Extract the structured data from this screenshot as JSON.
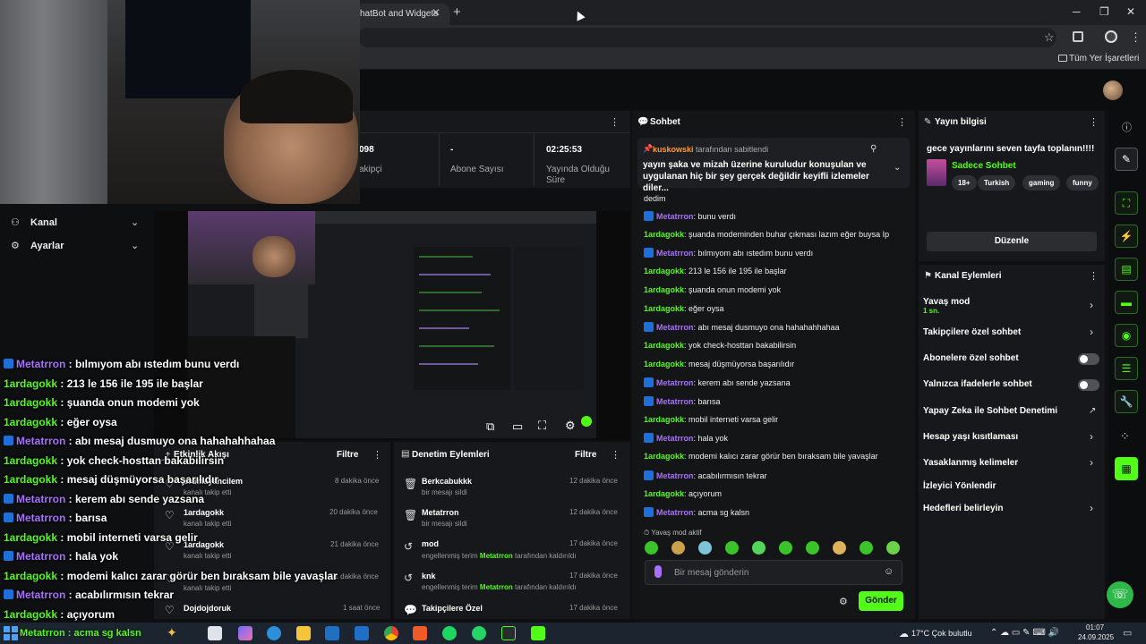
{
  "browser": {
    "tab_title": "hatBot and Widgets",
    "tab_close": "✕",
    "new_tab": "+",
    "bookmark": "Tüm Yer İşaretleri",
    "win_min": "─",
    "win_max": "❐",
    "win_close": "✕"
  },
  "stats": [
    {
      "value": "098",
      "label": "akipçi"
    },
    {
      "value": "-",
      "label": "Abone Sayısı"
    },
    {
      "value": "02:25:53",
      "label": "Yayında Olduğu Süre"
    }
  ],
  "menu": {
    "kanal": "Kanal",
    "ayarlar": "Ayarlar"
  },
  "overlay_chat": [
    {
      "user": "Metatrron",
      "msg": " : bılmıyom abı ıstedım bunu verdı",
      "badge": true
    },
    {
      "user": "1ardagokk",
      "msg": " : 213 le 156 ile 195 ile başlar",
      "badge": false
    },
    {
      "user": "1ardagokk",
      "msg": " : şuanda onun modemi yok",
      "badge": false
    },
    {
      "user": "1ardagokk",
      "msg": " : eğer oysa",
      "badge": false
    },
    {
      "user": "Metatrron",
      "msg": " : abı mesaj dusmuyo ona hahahahhahaa",
      "badge": true
    },
    {
      "user": "1ardagokk",
      "msg": " : yok check-hosttan bakabilirsin",
      "badge": false
    },
    {
      "user": "1ardagokk",
      "msg": " : mesaj düşmüyorsa başarılıdır",
      "badge": false
    },
    {
      "user": "Metatrron",
      "msg": " : kerem abı sende yazsana",
      "badge": true
    },
    {
      "user": "Metatrron",
      "msg": " : barısa",
      "badge": true
    },
    {
      "user": "1ardagokk",
      "msg": " : mobil interneti varsa gelir",
      "badge": false
    },
    {
      "user": "Metatrron",
      "msg": " : hala yok",
      "badge": true
    },
    {
      "user": "1ardagokk",
      "msg": " : modemi kalıcı zarar görür ben bıraksam bile yavaşlar",
      "badge": false
    },
    {
      "user": "Metatrron",
      "msg": " : acabılırmısın tekrar",
      "badge": true
    },
    {
      "user": "1ardagokk",
      "msg": " : açıyorum",
      "badge": false
    }
  ],
  "overlay_bottom": "Metatrron : acma sg kalsn",
  "activity": {
    "title": "Etkinlik Akışı",
    "filter": "Filtre",
    "rows": [
      {
        "name": "orumayancilem",
        "sub": "kanalı takip etti",
        "time": "8 dakika önce"
      },
      {
        "name": "1ardagokk",
        "sub": "kanalı takip etti",
        "time": "20 dakika önce"
      },
      {
        "name": "1ardagokk",
        "sub": "kanalı takip etti",
        "time": "21 dakika önce"
      },
      {
        "name": "",
        "sub": "kanalı takip etti",
        "time": "51 dakika önce"
      },
      {
        "name": "Dojdojdoruk",
        "sub": "",
        "time": "1 saat önce"
      }
    ]
  },
  "moderation": {
    "title": "Denetim Eylemleri",
    "filter": "Filtre",
    "rows": [
      {
        "name": "Berkcabukkk",
        "sub": "bir mesajı sildi",
        "time": "12 dakika önce"
      },
      {
        "name": "Metatrron",
        "sub": "bir mesajı sildi",
        "time": "12 dakika önce"
      },
      {
        "name": "mod",
        "sub_pre": "engellenmiş terim ",
        "sub_user": "Metatrron",
        "sub_post": " tarafından kaldırıldı",
        "time": "17 dakika önce"
      },
      {
        "name": "knk",
        "sub_pre": "engellenmiş terim ",
        "sub_user": "Metatrron",
        "sub_post": " tarafından kaldırıldı",
        "time": "17 dakika önce"
      },
      {
        "name": "Takipçilere Özel",
        "sub": "",
        "time": "17 dakika önce"
      }
    ]
  },
  "chat": {
    "title": "Sohbet",
    "pinned_user": "kuskowski",
    "pinned_by": " tarafından sabitlendi",
    "pinned_text": "yayın şaka ve mizah üzerine kuruludur konuşulan ve uygulanan hiç bir şey gerçek değildir keyifli izlemeler diler...",
    "partial": "dedim",
    "lines": [
      {
        "user": "Metatrron",
        "msg": ": bunu verdı",
        "mod": true
      },
      {
        "user": "1ardagokk",
        "msg": ": şuanda modeminden buhar çıkması lazım eğer buysa Ip",
        "mod": false
      },
      {
        "user": "Metatrron",
        "msg": ": bılmıyom abı ıstedım bunu verdı",
        "mod": true
      },
      {
        "user": "1ardagokk",
        "msg": ": 213 le 156 ile 195 ile başlar",
        "mod": false
      },
      {
        "user": "1ardagokk",
        "msg": ": şuanda onun modemi yok",
        "mod": false
      },
      {
        "user": "1ardagokk",
        "msg": ": eğer oysa",
        "mod": false
      },
      {
        "user": "Metatrron",
        "msg": ": abı mesaj dusmuyo ona hahahahhahaa",
        "mod": true
      },
      {
        "user": "1ardagokk",
        "msg": ": yok check-hosttan bakabilirsin",
        "mod": false
      },
      {
        "user": "1ardagokk",
        "msg": ": mesaj düşmüyorsa başarılıdır",
        "mod": false
      },
      {
        "user": "Metatrron",
        "msg": ": kerem abı sende yazsana",
        "mod": true
      },
      {
        "user": "Metatrron",
        "msg": ": barısa",
        "mod": true
      },
      {
        "user": "1ardagokk",
        "msg": ": mobil interneti varsa gelir",
        "mod": false
      },
      {
        "user": "Metatrron",
        "msg": ": hala yok",
        "mod": true
      },
      {
        "user": "1ardagokk",
        "msg": ": modemi kalıcı zarar görür ben bıraksam bile yavaşlar",
        "mod": false
      },
      {
        "user": "Metatrron",
        "msg": ": acabılırmısın tekrar",
        "mod": true
      },
      {
        "user": "1ardagokk",
        "msg": ": açıyorum",
        "mod": false
      },
      {
        "user": "Metatrron",
        "msg": ": acma sg kalsn",
        "mod": true
      }
    ],
    "slow_mode": "Yavaş mod aktif",
    "input_placeholder": "Bir mesaj gönderin",
    "send": "Gönder"
  },
  "stream_info": {
    "title": "Yayın bilgisi",
    "stream_title": "gece yayınlarını seven tayfa toplanın!!!!",
    "category": "Sadece Sohbet",
    "tags": [
      "18+",
      "Turkish",
      "gaming",
      "funny"
    ],
    "edit": "Düzenle"
  },
  "channel_actions": {
    "title": "Kanal Eylemleri",
    "slow_mode": "Yavaş mod",
    "slow_value": "1 sn.",
    "items": [
      {
        "label": "Takipçilere özel sohbet",
        "control": "chevron"
      },
      {
        "label": "Abonelere özel sohbet",
        "control": "toggle"
      },
      {
        "label": "Yalnızca ifadelerle sohbet",
        "control": "toggle"
      },
      {
        "label": "Yapay Zeka ile Sohbet Denetimi",
        "control": "external"
      },
      {
        "label": "Hesap yaşı kısıtlaması",
        "control": "chevron"
      },
      {
        "label": "Yasaklanmış kelimeler",
        "control": "chevron"
      },
      {
        "label": "İzleyici Yönlendir",
        "control": "none"
      },
      {
        "label": "Hedefleri belirleyin",
        "control": "chevron"
      }
    ]
  },
  "taskbar": {
    "weather": "17°C  Çok bulutlu",
    "time": "01:07",
    "date": "24.09.2025"
  }
}
